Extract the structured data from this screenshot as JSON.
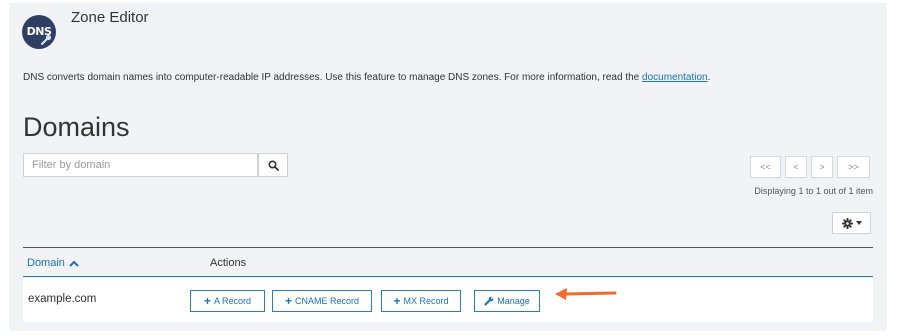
{
  "header": {
    "logo_text": "DNS",
    "title": "Zone Editor"
  },
  "description": {
    "text": "DNS converts domain names into computer-readable IP addresses. Use this feature to manage DNS zones. For more information, read the ",
    "link": "documentation",
    "suffix": "."
  },
  "section_title": "Domains",
  "search": {
    "placeholder": "Filter by domain",
    "value": ""
  },
  "pagination": {
    "first": "<<",
    "prev": "<",
    "next": ">",
    "last": ">>",
    "info": "Displaying 1 to 1 out of 1 item"
  },
  "table": {
    "col_domain": "Domain",
    "col_actions": "Actions",
    "rows": [
      {
        "domain": "example.com",
        "actions": {
          "a_record": "A Record",
          "cname_record": "CNAME Record",
          "mx_record": "MX Record",
          "manage": "Manage"
        }
      }
    ]
  },
  "icons": {
    "search": "search-icon",
    "gear": "gear-icon",
    "sort": "chevron-up-icon",
    "wrench": "wrench-icon",
    "arrow": "arrow-left-icon"
  },
  "colors": {
    "accent": "#1a73b6",
    "annotation_arrow": "#f26b2a",
    "logo_bg": "#2f3f63"
  }
}
